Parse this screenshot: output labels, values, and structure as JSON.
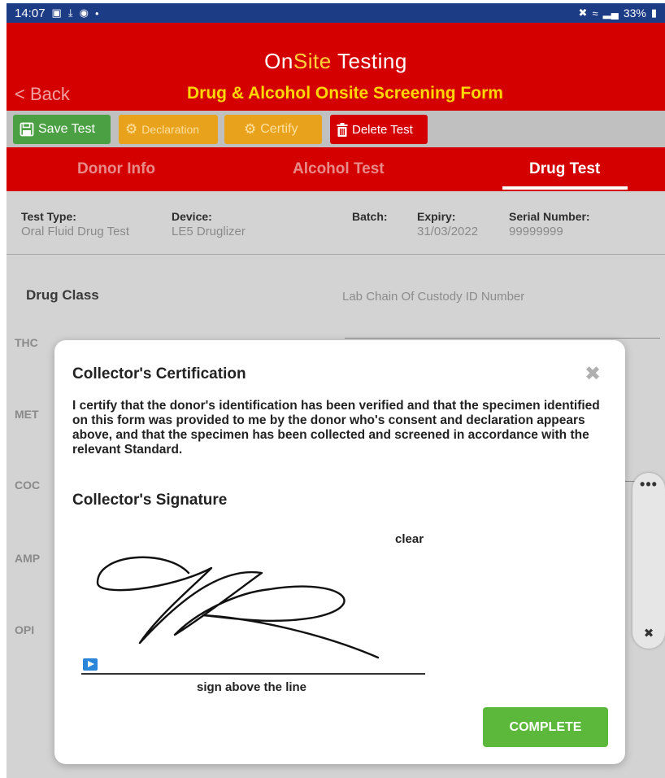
{
  "status_bar": {
    "time": "14:07",
    "battery": "33%",
    "icons": [
      "image-icon",
      "download-icon",
      "account-icon",
      "dot-icon",
      "mute-icon",
      "wifi-icon",
      "signal-icon",
      "battery-icon"
    ]
  },
  "header": {
    "brand_part1": "On",
    "brand_part2": "Site",
    "brand_part3": "Testing",
    "back_label": "< Back",
    "title": "Drug & Alcohol Onsite Screening Form"
  },
  "toolbar": {
    "save_label": "Save Test",
    "declaration_label": "Declaration",
    "certify_label": "Certify",
    "delete_label": "Delete Test"
  },
  "tabs": [
    {
      "label": "Donor Info",
      "active": false
    },
    {
      "label": "Alcohol Test",
      "active": false
    },
    {
      "label": "Drug Test",
      "active": true
    }
  ],
  "test_info": {
    "test_type_label": "Test Type:",
    "test_type_value": "Oral Fluid Drug Test",
    "device_label": "Device:",
    "device_value": "LE5 Druglizer",
    "batch_label": "Batch:",
    "expiry_label": "Expiry:",
    "expiry_value": "31/03/2022",
    "serial_label": "Serial Number:",
    "serial_value": "99999999"
  },
  "drug_panel": {
    "drug_class_label": "Drug Class",
    "lab_chain_label": "Lab Chain Of Custody ID Number",
    "drug_classes": [
      "THC",
      "MET",
      "COC",
      "AMP",
      "OPI"
    ]
  },
  "side_panel": {
    "more_label": "•••"
  },
  "modal": {
    "title": "Collector's Certification",
    "close_symbol": "✖",
    "body": "I certify that the donor's identification has been verified and that the specimen identified on this form was provided to me by the donor who's consent and declaration appears above, and that the specimen has been collected and screened in accordance with the relevant Standard.",
    "signature_heading": "Collector's Signature",
    "clear_label": "clear",
    "sign_caption": "sign above the line",
    "complete_label": "COMPLETE"
  },
  "colors": {
    "status_bar": "#1d3c86",
    "brand_red": "#d40000",
    "brand_yellow": "#ffd700",
    "save_green": "#4aa043",
    "orange": "#e8a21b",
    "complete_green": "#5cb83a",
    "content_gray": "#d3d3d3"
  }
}
